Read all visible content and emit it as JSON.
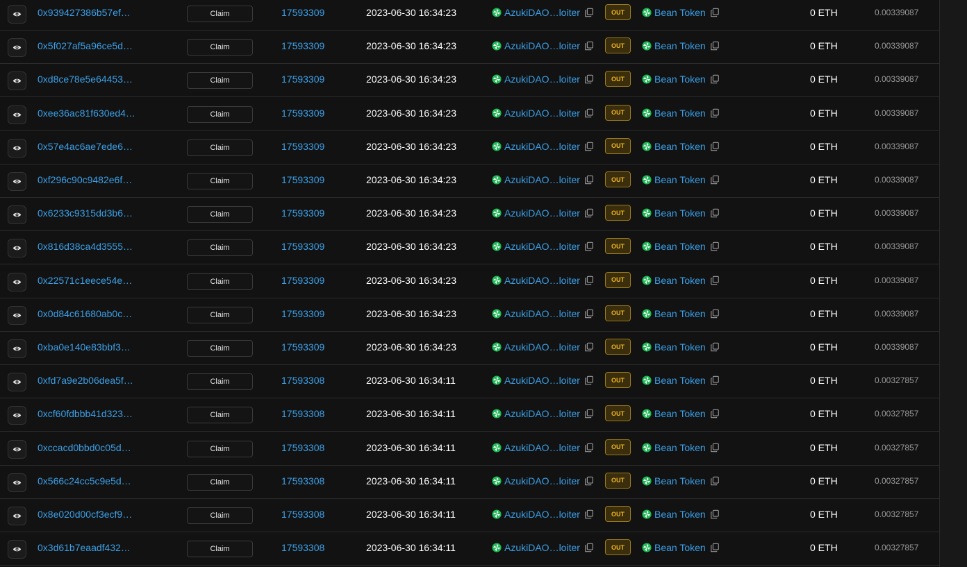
{
  "colors": {
    "link": "#3ba0e8",
    "out_badge_text": "#f0b520",
    "out_badge_bg": "#3a2e0c",
    "background": "#121212",
    "token_icon": "#1db954"
  },
  "icons": {
    "view": "eye-icon",
    "copy": "copy-icon",
    "token": "pinwheel-token-icon"
  },
  "rows": [
    {
      "hash": "0x939427386b57ef…",
      "method": "Claim",
      "block": "17593309",
      "age": "2023-06-30 16:34:23",
      "from": "AzukiDAO…loiter",
      "direction": "OUT",
      "to": "Bean Token",
      "value": "0 ETH",
      "fee": "0.00339087"
    },
    {
      "hash": "0x5f027af5a96ce5d…",
      "method": "Claim",
      "block": "17593309",
      "age": "2023-06-30 16:34:23",
      "from": "AzukiDAO…loiter",
      "direction": "OUT",
      "to": "Bean Token",
      "value": "0 ETH",
      "fee": "0.00339087"
    },
    {
      "hash": "0xd8ce78e5e64453…",
      "method": "Claim",
      "block": "17593309",
      "age": "2023-06-30 16:34:23",
      "from": "AzukiDAO…loiter",
      "direction": "OUT",
      "to": "Bean Token",
      "value": "0 ETH",
      "fee": "0.00339087"
    },
    {
      "hash": "0xee36ac81f630ed4…",
      "method": "Claim",
      "block": "17593309",
      "age": "2023-06-30 16:34:23",
      "from": "AzukiDAO…loiter",
      "direction": "OUT",
      "to": "Bean Token",
      "value": "0 ETH",
      "fee": "0.00339087"
    },
    {
      "hash": "0x57e4ac6ae7ede6…",
      "method": "Claim",
      "block": "17593309",
      "age": "2023-06-30 16:34:23",
      "from": "AzukiDAO…loiter",
      "direction": "OUT",
      "to": "Bean Token",
      "value": "0 ETH",
      "fee": "0.00339087"
    },
    {
      "hash": "0xf296c90c9482e6f…",
      "method": "Claim",
      "block": "17593309",
      "age": "2023-06-30 16:34:23",
      "from": "AzukiDAO…loiter",
      "direction": "OUT",
      "to": "Bean Token",
      "value": "0 ETH",
      "fee": "0.00339087"
    },
    {
      "hash": "0x6233c9315dd3b6…",
      "method": "Claim",
      "block": "17593309",
      "age": "2023-06-30 16:34:23",
      "from": "AzukiDAO…loiter",
      "direction": "OUT",
      "to": "Bean Token",
      "value": "0 ETH",
      "fee": "0.00339087"
    },
    {
      "hash": "0x816d38ca4d3555…",
      "method": "Claim",
      "block": "17593309",
      "age": "2023-06-30 16:34:23",
      "from": "AzukiDAO…loiter",
      "direction": "OUT",
      "to": "Bean Token",
      "value": "0 ETH",
      "fee": "0.00339087"
    },
    {
      "hash": "0x22571c1eece54e…",
      "method": "Claim",
      "block": "17593309",
      "age": "2023-06-30 16:34:23",
      "from": "AzukiDAO…loiter",
      "direction": "OUT",
      "to": "Bean Token",
      "value": "0 ETH",
      "fee": "0.00339087"
    },
    {
      "hash": "0x0d84c61680ab0c…",
      "method": "Claim",
      "block": "17593309",
      "age": "2023-06-30 16:34:23",
      "from": "AzukiDAO…loiter",
      "direction": "OUT",
      "to": "Bean Token",
      "value": "0 ETH",
      "fee": "0.00339087"
    },
    {
      "hash": "0xba0e140e83bbf3…",
      "method": "Claim",
      "block": "17593309",
      "age": "2023-06-30 16:34:23",
      "from": "AzukiDAO…loiter",
      "direction": "OUT",
      "to": "Bean Token",
      "value": "0 ETH",
      "fee": "0.00339087"
    },
    {
      "hash": "0xfd7a9e2b06dea5f…",
      "method": "Claim",
      "block": "17593308",
      "age": "2023-06-30 16:34:11",
      "from": "AzukiDAO…loiter",
      "direction": "OUT",
      "to": "Bean Token",
      "value": "0 ETH",
      "fee": "0.00327857"
    },
    {
      "hash": "0xcf60fdbbb41d323…",
      "method": "Claim",
      "block": "17593308",
      "age": "2023-06-30 16:34:11",
      "from": "AzukiDAO…loiter",
      "direction": "OUT",
      "to": "Bean Token",
      "value": "0 ETH",
      "fee": "0.00327857"
    },
    {
      "hash": "0xccacd0bbd0c05d…",
      "method": "Claim",
      "block": "17593308",
      "age": "2023-06-30 16:34:11",
      "from": "AzukiDAO…loiter",
      "direction": "OUT",
      "to": "Bean Token",
      "value": "0 ETH",
      "fee": "0.00327857"
    },
    {
      "hash": "0x566c24cc5c9e5d…",
      "method": "Claim",
      "block": "17593308",
      "age": "2023-06-30 16:34:11",
      "from": "AzukiDAO…loiter",
      "direction": "OUT",
      "to": "Bean Token",
      "value": "0 ETH",
      "fee": "0.00327857"
    },
    {
      "hash": "0x8e020d00cf3ecf9…",
      "method": "Claim",
      "block": "17593308",
      "age": "2023-06-30 16:34:11",
      "from": "AzukiDAO…loiter",
      "direction": "OUT",
      "to": "Bean Token",
      "value": "0 ETH",
      "fee": "0.00327857"
    },
    {
      "hash": "0x3d61b7eaadf432…",
      "method": "Claim",
      "block": "17593308",
      "age": "2023-06-30 16:34:11",
      "from": "AzukiDAO…loiter",
      "direction": "OUT",
      "to": "Bean Token",
      "value": "0 ETH",
      "fee": "0.00327857"
    }
  ]
}
